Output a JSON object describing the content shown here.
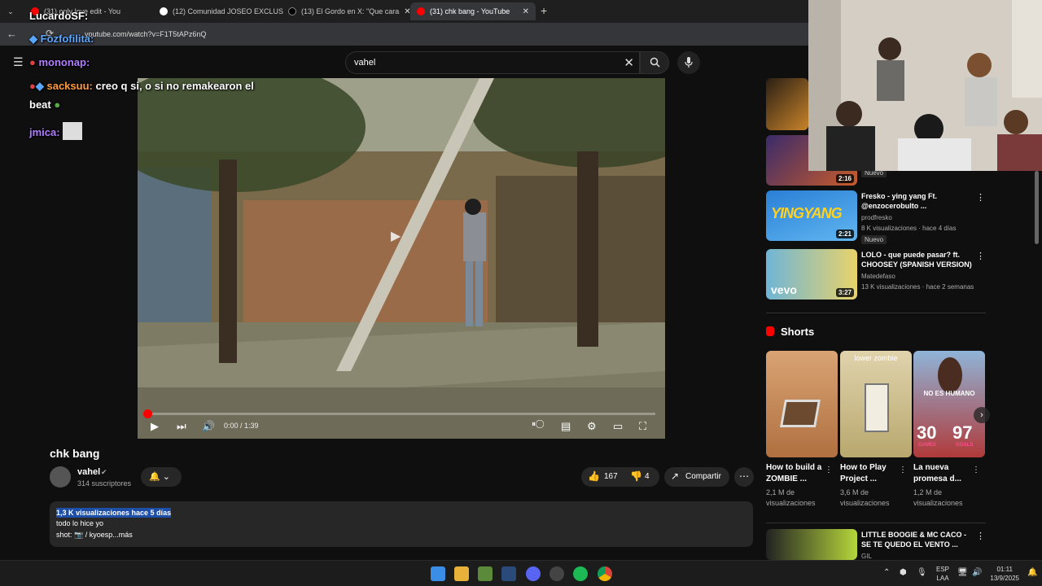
{
  "browser": {
    "tabs": [
      {
        "label": "(31) only love edit - You",
        "color": "#ff0000"
      },
      {
        "label": "(12) Comunidad JOSEO EXCLUS",
        "color": "#ffffff"
      },
      {
        "label": "(13) El Gordo en X: \"Que cara",
        "color": "#000000"
      },
      {
        "label": "(31) chk bang - YouTube",
        "color": "#ff0000"
      }
    ],
    "url": "youtube.com/watch?v=F1T5tAPz6nQ"
  },
  "youtube": {
    "search_value": "vahel",
    "video": {
      "time": "0:00 / 1:39",
      "progress": 0.0,
      "title": "chk bang",
      "channel": "vahel",
      "subscribers": "314 suscriptores",
      "likes": "167",
      "dislikes": "4",
      "share_label": "Compartir",
      "description": {
        "meta": "1,3 K visualizaciones  hace 5 días",
        "line1": "todo lo hice yo",
        "line2": "shot: 📷 / kyoesp...más"
      }
    },
    "recommendations": [
      {
        "title": "",
        "channel": "",
        "stats": "",
        "badge": "Nuevo",
        "duration": "2:16",
        "thumb": [
          "#3a2b6b",
          "#c95b2a"
        ]
      },
      {
        "title": "Fresko - ying yang  Ft. @enzocerobulto ...",
        "channel": "prodfresko",
        "stats": "8 K visualizaciones · hace 4 días",
        "badge": "Nuevo",
        "duration": "2:21",
        "thumb": [
          "#2a7fd6",
          "#ffd21f"
        ]
      },
      {
        "title": "LOLO - que puede pasar? ft. CHOOSEY (SPANISH VERSION)",
        "channel": "Matedefaso",
        "stats": "13 K visualizaciones · hace 2 semanas",
        "badge": "",
        "duration": "3:27",
        "thumb": [
          "#6fb5d6",
          "#e8d36a"
        ]
      },
      {
        "title": "LITTLE BOOGIE & MC CACO - SE TE QUEDO EL VENTO ...",
        "channel": "GIL",
        "stats": "",
        "badge": "",
        "duration": "",
        "thumb": [
          "#222222",
          "#b5d63a"
        ]
      }
    ],
    "shorts_heading": "Shorts",
    "shorts": [
      {
        "title": "How to build a ZOMBIE ...",
        "views": "2,1 M de visualizaciones",
        "color": "#c98c5a"
      },
      {
        "title": "How to Play Project ...",
        "views": "3,6 M de visualizaciones",
        "color": "#c9b88a",
        "overlay": "lower zombie"
      },
      {
        "title": "La nueva promesa d...",
        "views": "1,2 M de visualizaciones",
        "color": "#a83c3c",
        "overlay": "NO ES HUMANO",
        "stat1": "30",
        "stat1_label": "GAMES",
        "stat2": "97",
        "stat2_label": "GOALS"
      }
    ]
  },
  "chat": [
    {
      "user": "LucardoSF:",
      "text": "",
      "color": "#ffffff"
    },
    {
      "user": "Fozfofilita:",
      "text": "",
      "color": "#5aa6ff"
    },
    {
      "user": "mononap:",
      "text": "",
      "color": "#b07cff"
    },
    {
      "user": "sacksuu:",
      "text": "creo q si, o si no remakearon el",
      "color": "#ff9a3c"
    },
    {
      "user": "",
      "text": "beat",
      "color": "#ffffff"
    },
    {
      "user": "jmica:",
      "text": "",
      "color": "#b07cff"
    }
  ],
  "taskbar": {
    "lang": "ESP",
    "lang2": "LAA",
    "time": "01:11",
    "date": "13/9/2025"
  }
}
